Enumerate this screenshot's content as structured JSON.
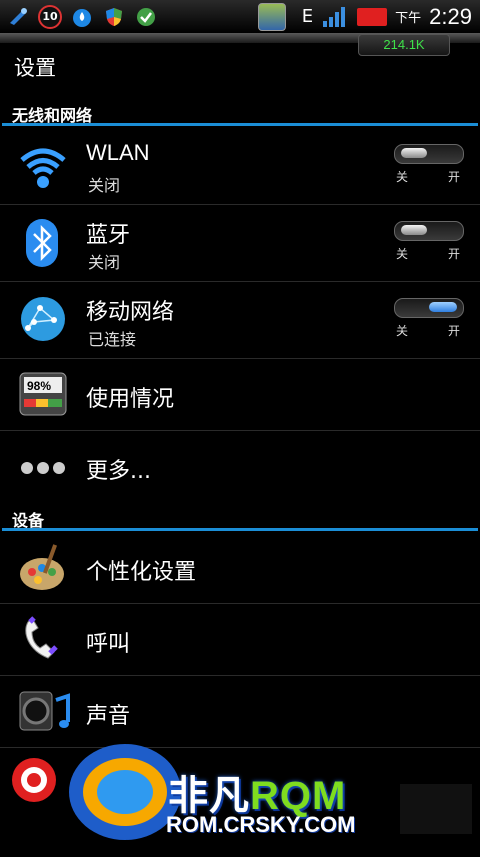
{
  "status_bar": {
    "notification_badge": "10",
    "network_type": "E",
    "ampm": "下午",
    "time": "2:29",
    "net_speed": "214.1K"
  },
  "title": "设置",
  "sections": {
    "wireless": "无线和网络",
    "device": "设备"
  },
  "toggle_labels": {
    "off": "关",
    "on": "开"
  },
  "items": {
    "wlan": {
      "label": "WLAN",
      "status": "关闭",
      "toggle_on": false
    },
    "bluetooth": {
      "label": "蓝牙",
      "status": "关闭",
      "toggle_on": false
    },
    "mobile": {
      "label": "移动网络",
      "status": "已连接",
      "toggle_on": true
    },
    "usage": {
      "label": "使用情况",
      "battery_text": "98%"
    },
    "more": {
      "label": "更多..."
    },
    "personalize": {
      "label": "个性化设置"
    },
    "call": {
      "label": "呼叫"
    },
    "sound": {
      "label": "声音"
    }
  },
  "watermark": {
    "brand_cn": "非凡",
    "brand_rom": "RQM",
    "url": "ROM.CRSKY.COM"
  },
  "colors": {
    "accent": "#1b8ed6",
    "net_speed": "#3fe24a",
    "watermark_rom": "#7fdc1f"
  }
}
